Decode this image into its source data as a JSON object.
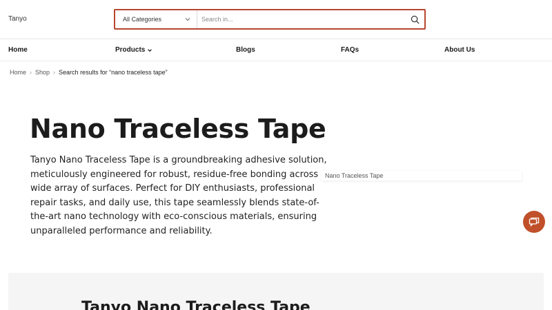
{
  "header": {
    "logo_text": "Tanyo",
    "category_select": "All Categories",
    "search_placeholder": "Search in..."
  },
  "nav": {
    "items": [
      {
        "label": "Home"
      },
      {
        "label": "Products"
      },
      {
        "label": "Blogs"
      },
      {
        "label": "FAQs"
      },
      {
        "label": "About Us"
      }
    ]
  },
  "breadcrumb": {
    "home": "Home",
    "shop": "Shop",
    "current": "Search results for “nano traceless tape”"
  },
  "hero": {
    "title": "Nano Traceless Tape",
    "description": "Tanyo Nano Traceless Tape is a groundbreaking adhesive solution, meticulously engineered for robust, residue-free bonding across a wide array of surfaces. Perfect for DIY enthusiasts, professional repair tasks, and daily use, this tape seamlessly blends state-of-the-art nano technology with eco-conscious materials, ensuring unparalleled performance and reliability.",
    "image_alt": "Nano Traceless Tape"
  },
  "section": {
    "title": "Tanyo Nano Traceless Tape"
  },
  "colors": {
    "accent": "#b5462e",
    "chat_button": "#c0502a",
    "section_bg": "#f5f5f5"
  },
  "icons": {
    "search": "search-icon",
    "dropdown": "chevron-down-icon",
    "chat": "chat-icon"
  }
}
